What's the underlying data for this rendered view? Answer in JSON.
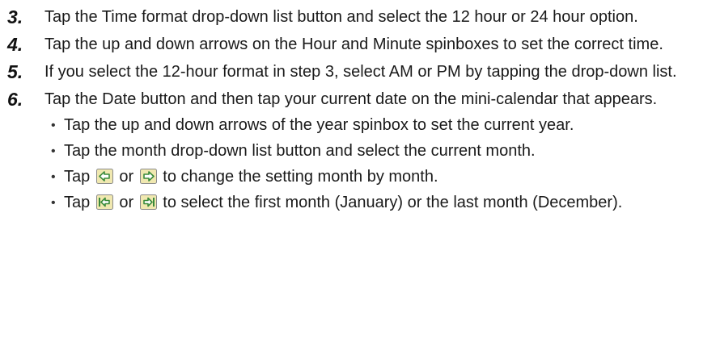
{
  "steps": [
    {
      "number": "3.",
      "text": "Tap the Time format drop-down list button and select the 12 hour or 24 hour option."
    },
    {
      "number": "4.",
      "text": "Tap the up and down arrows on the Hour and Minute spinboxes to set the correct time."
    },
    {
      "number": "5.",
      "text": "If you select the 12-hour format in step 3, select AM or PM by tapping the drop-down list."
    },
    {
      "number": "6.",
      "text": "Tap the Date button and then tap your current date on the mini-calendar that appears."
    }
  ],
  "bullets": {
    "b1": "Tap the up and down arrows of the year spinbox to set the current year.",
    "b2": "Tap the month drop-down list button and select the current month.",
    "b3": {
      "pre": "Tap",
      "mid": "or",
      "post": "to change the setting month by month."
    },
    "b4": {
      "pre": "Tap",
      "mid": "or",
      "post": "to select the first month (January) or the last month (December)."
    }
  },
  "icons": {
    "prev_month": "left-arrow-icon",
    "next_month": "right-arrow-icon",
    "first_month": "first-month-icon",
    "last_month": "last-month-icon"
  },
  "colors": {
    "icon_fill": "#f0e8b0",
    "icon_border": "#8a8a8a",
    "icon_arrow": "#3a8a3a"
  }
}
